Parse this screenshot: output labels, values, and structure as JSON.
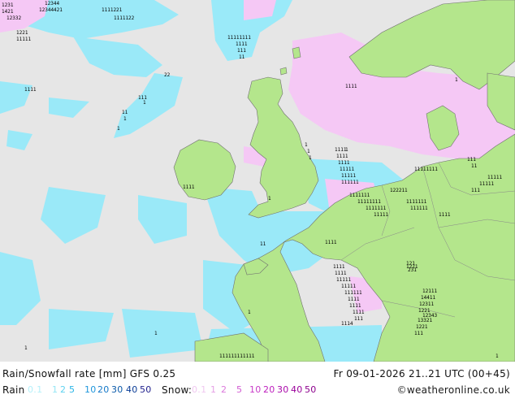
{
  "header": {
    "title": "Rain/Snowfall rate [mm] GFS 0.25",
    "datetime": "Fr 09-01-2026 21..21 UTC (00+45)"
  },
  "legend": {
    "rain_label": "Rain",
    "rain_levels": [
      "0.1",
      "1",
      "2",
      "5",
      "10",
      "20",
      "30",
      "40",
      "50"
    ],
    "rain_colors": [
      "#b4f0fa",
      "#96e6f5",
      "#5fd2f0",
      "#28b4e6",
      "#1e96dc",
      "#1478c8",
      "#0a5aaa",
      "#0a3c96",
      "#1e1e8c"
    ],
    "snow_label": "Snow:",
    "snow_levels": [
      "0.1",
      "1",
      "2",
      "5",
      "10",
      "20",
      "30",
      "40",
      "50"
    ],
    "snow_colors": [
      "#f8d2f8",
      "#f0b4f0",
      "#e696e6",
      "#dc78dc",
      "#d25ad2",
      "#c83cc8",
      "#be1ebe",
      "#aa0aaa",
      "#8c008c"
    ]
  },
  "credit": "©weatheronline.co.uk",
  "map": {
    "colors": {
      "sea": "#e6e6e6",
      "land": "#b4e68c",
      "rain": "#96eafa",
      "snow": "#f5c8f5",
      "coast": "#707070",
      "border": "#888888",
      "precip_marker": "#000000"
    },
    "markers": [
      {
        "text": "1231"
      },
      {
        "text": "12344"
      },
      {
        "text": "1421"
      },
      {
        "text": "12332"
      },
      {
        "text": "1111221"
      },
      {
        "text": "12344421"
      },
      {
        "text": "1111122"
      },
      {
        "text": "11111111"
      },
      {
        "text": "11111"
      },
      {
        "text": "1221"
      },
      {
        "text": "22"
      },
      {
        "text": "1111"
      },
      {
        "text": "11111111"
      },
      {
        "text": "1111"
      },
      {
        "text": "122211"
      },
      {
        "text": "1"
      },
      {
        "text": "11"
      },
      {
        "text": "1111"
      },
      {
        "text": "1221"
      },
      {
        "text": "1111"
      },
      {
        "text": "1"
      },
      {
        "text": "12343"
      },
      {
        "text": "1114"
      },
      {
        "text": "1"
      },
      {
        "text": "1"
      },
      {
        "text": "111111111111"
      },
      {
        "text": "1111"
      }
    ]
  }
}
